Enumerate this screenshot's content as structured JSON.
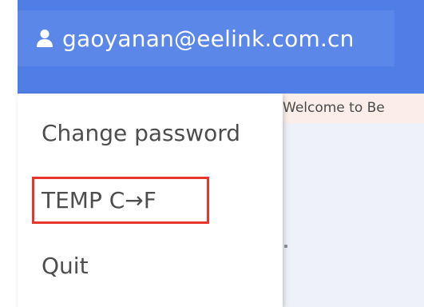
{
  "header": {
    "user_email": "gaoyanan@eelink.com.cn",
    "user_icon": "user-icon",
    "background_color": "#4f7fe6"
  },
  "banner": {
    "welcome_text": "Welcome to Be"
  },
  "menu": {
    "items": [
      {
        "label": "Change password"
      },
      {
        "label": "TEMP C→F",
        "highlighted": true
      },
      {
        "label": "Quit"
      }
    ],
    "highlight_color": "#e8362d"
  }
}
